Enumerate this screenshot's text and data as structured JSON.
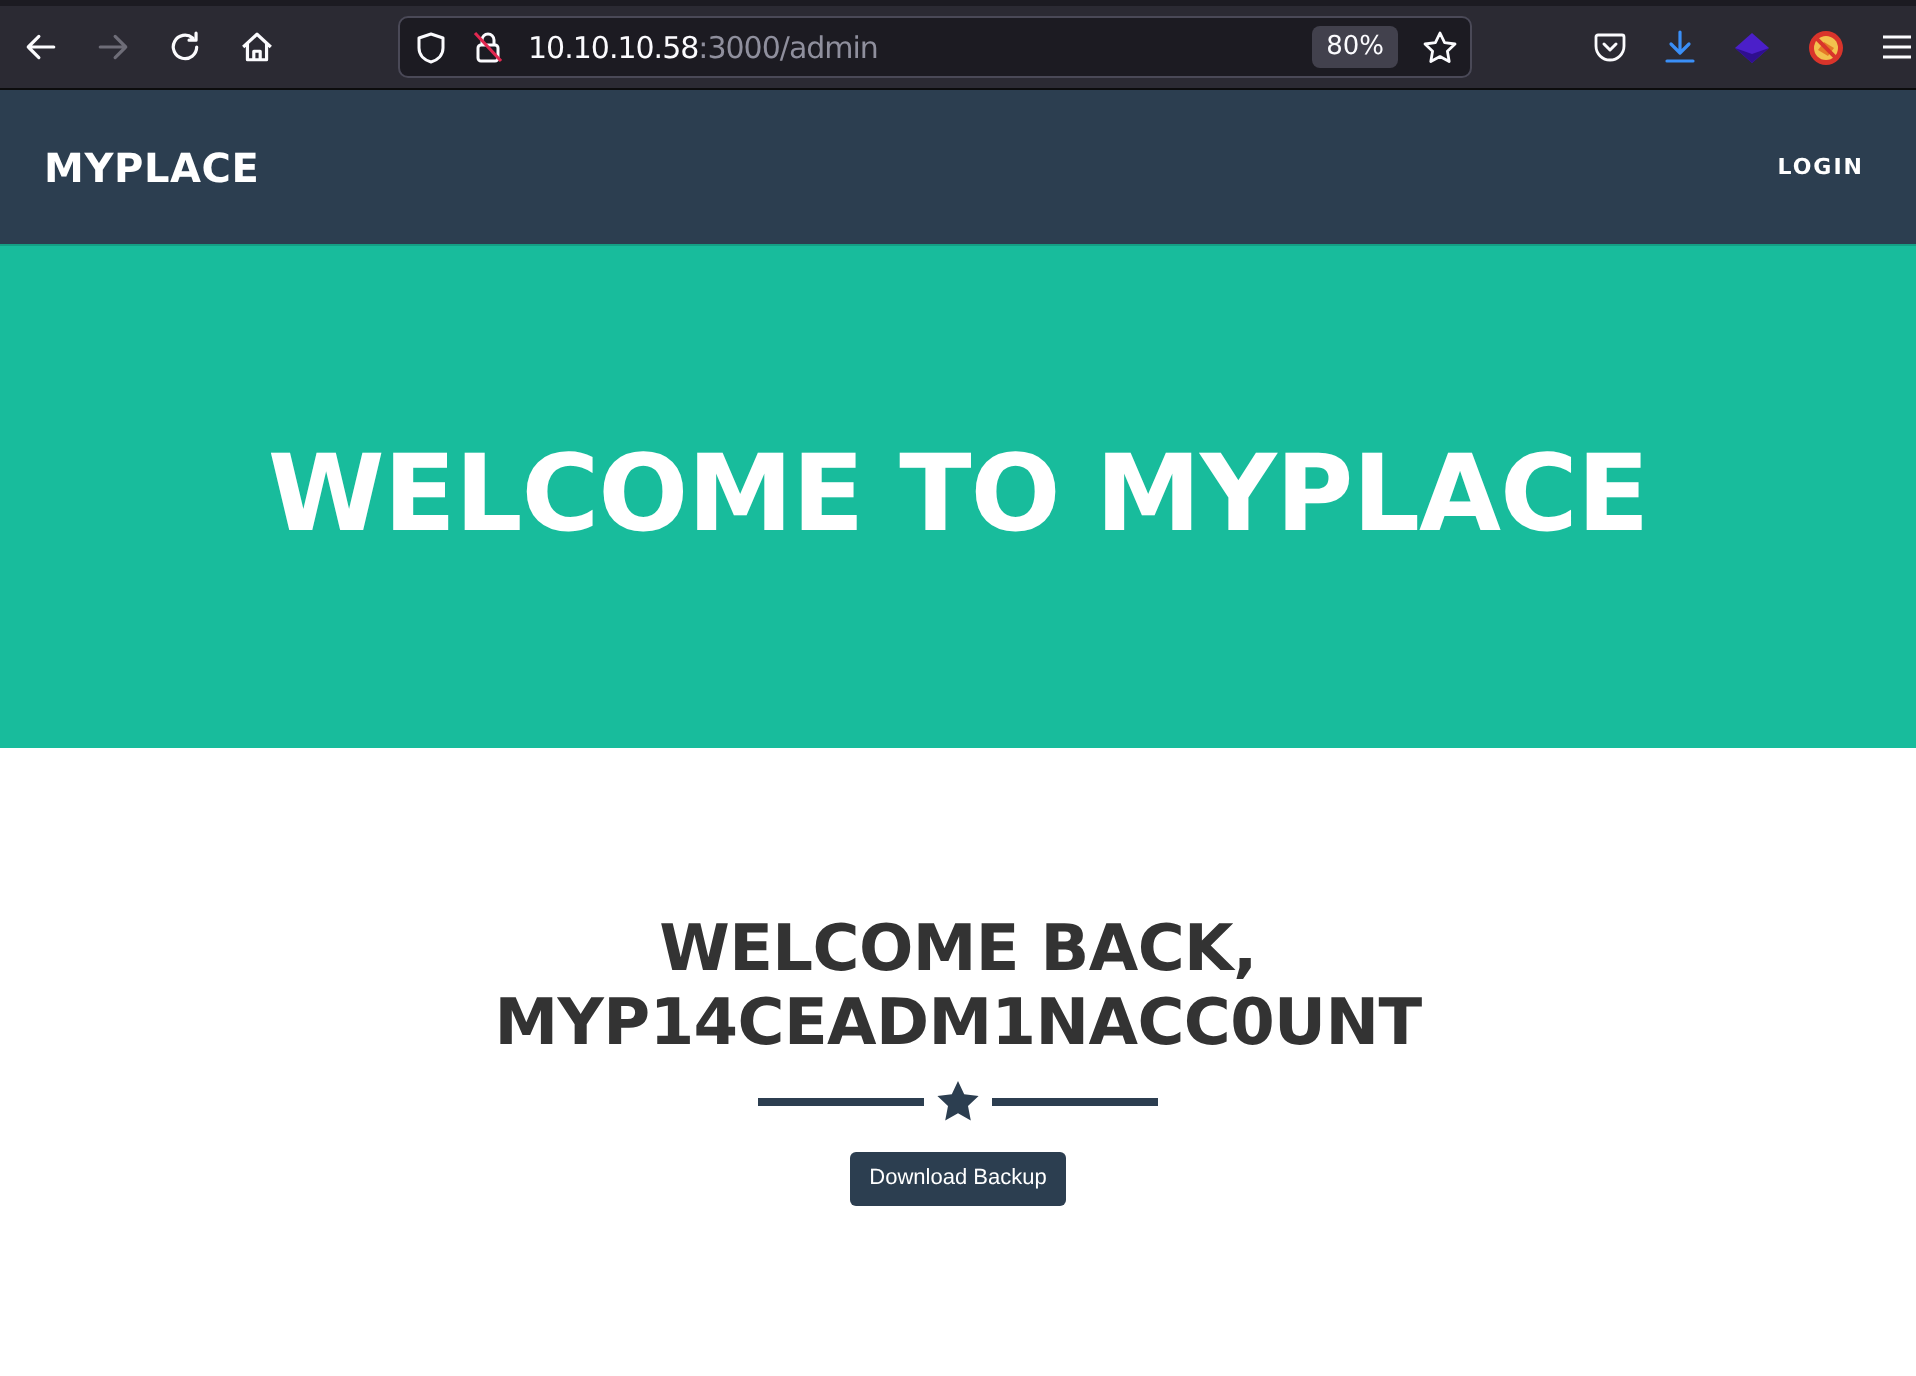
{
  "browser": {
    "nav_buttons": [
      {
        "kind": "back",
        "disabled": false
      },
      {
        "kind": "forward",
        "disabled": true
      },
      {
        "kind": "reload",
        "disabled": false
      },
      {
        "kind": "home",
        "disabled": false
      }
    ],
    "address": {
      "host": "10.10.10.58",
      "path": ":3000/admin"
    },
    "zoom": "80%"
  },
  "navbar": {
    "brand": "MYPLACE",
    "links": [
      "LOGIN"
    ]
  },
  "hero": {
    "title": "WELCOME TO MYPLACE"
  },
  "section": {
    "heading": "WELCOME BACK, MYP14CEADM1NACC0UNT",
    "button": "Download Backup"
  }
}
